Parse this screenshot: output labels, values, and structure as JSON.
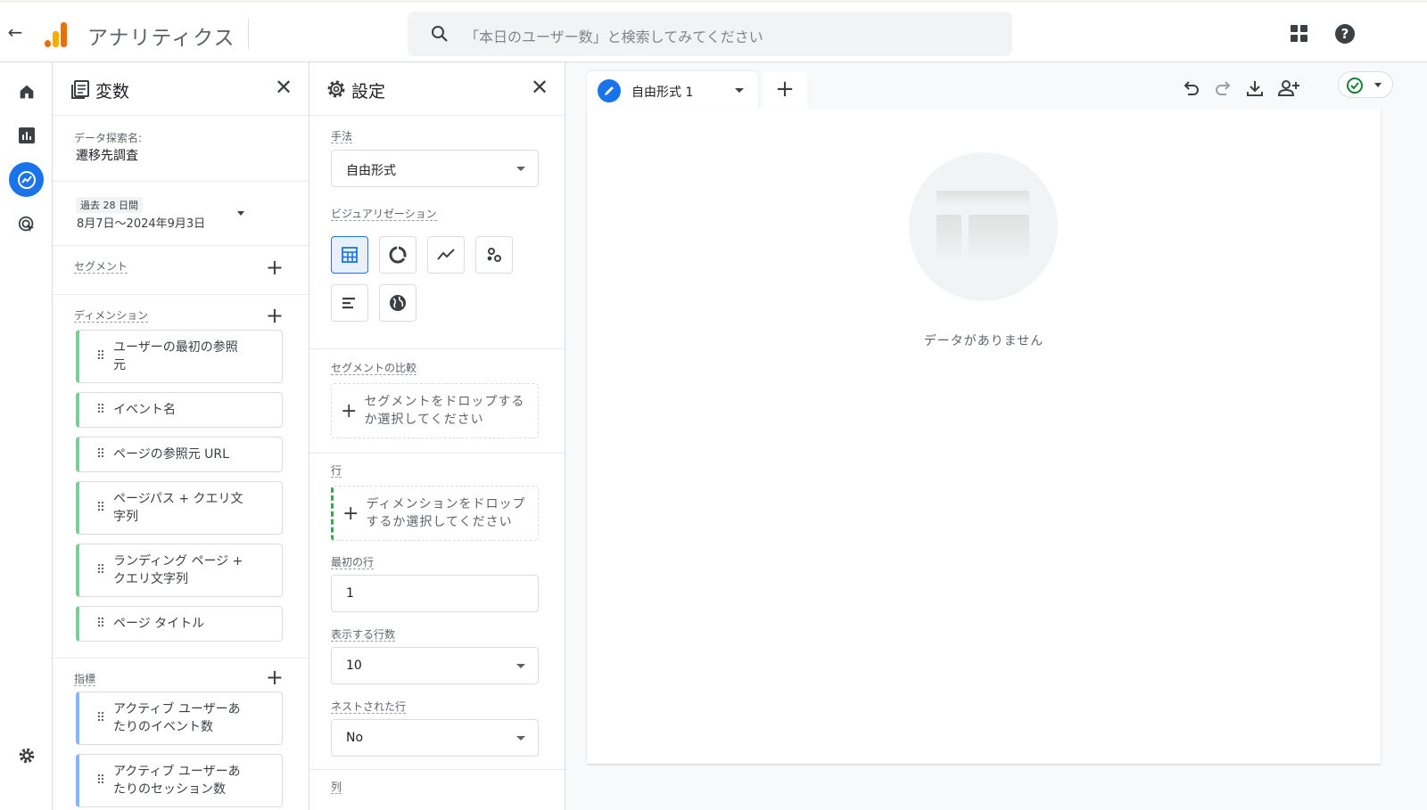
{
  "header": {
    "app_name": "アナリティクス",
    "search_placeholder": "「本日のユーザー数」と検索してみてください"
  },
  "variables": {
    "title": "変数",
    "exploration_name_label": "データ探索名:",
    "exploration_name": "遷移先調査",
    "date_range_badge": "過去 28 日間",
    "date_range": "8月7日～2024年9月3日",
    "segments_label": "セグメント",
    "dimensions_label": "ディメンション",
    "dimensions": [
      {
        "line1": "ユーザーの最初の参照",
        "line2": "元"
      },
      {
        "line1": "イベント名",
        "line2": ""
      },
      {
        "line1": "ページの参照元 URL",
        "line2": ""
      },
      {
        "line1": "ページパス + クエリ文",
        "line2": "字列"
      },
      {
        "line1": "ランディング ページ +",
        "line2": "クエリ文字列"
      },
      {
        "line1": "ページ タイトル",
        "line2": ""
      }
    ],
    "metrics_label": "指標",
    "metrics": [
      {
        "line1": "アクティブ ユーザーあ",
        "line2": "たりのイベント数"
      },
      {
        "line1": "アクティブ ユーザーあ",
        "line2": "たりのセッション数"
      }
    ]
  },
  "settings": {
    "title": "設定",
    "technique_label": "手法",
    "technique_value": "自由形式",
    "visualization_label": "ビジュアリゼーション",
    "segment_compare_label": "セグメントの比較",
    "segment_drop_line1": "セグメントをドロップする",
    "segment_drop_line2": "か選択してください",
    "rows_label": "行",
    "rows_drop_line1": "ディメンションをドロップ",
    "rows_drop_line2": "するか選択してください",
    "first_row_label": "最初の行",
    "first_row_value": "1",
    "rows_to_show_label": "表示する行数",
    "rows_to_show_value": "10",
    "nested_rows_label": "ネストされた行",
    "nested_rows_value": "No",
    "columns_label": "列"
  },
  "workspace": {
    "tab_name": "自由形式 1",
    "empty_message": "データがありません"
  },
  "colors": {
    "accent": "#1a73e8",
    "dimension_chip": "#81c995",
    "metric_chip": "#8ab4f8",
    "status_green": "#188038"
  },
  "icons": [
    "back-arrow-icon",
    "analytics-logo-icon",
    "search-icon",
    "apps-grid-icon",
    "help-icon",
    "home-icon",
    "reports-icon",
    "explore-icon",
    "advertising-icon",
    "settings-gear-icon",
    "variables-icon",
    "close-icon",
    "plus-icon",
    "drag-handle-icon",
    "table-icon",
    "donut-icon",
    "line-chart-icon",
    "scatter-icon",
    "bar-chart-icon",
    "globe-icon",
    "pencil-icon",
    "undo-icon",
    "redo-icon",
    "download-icon",
    "share-user-icon",
    "check-circle-icon"
  ]
}
